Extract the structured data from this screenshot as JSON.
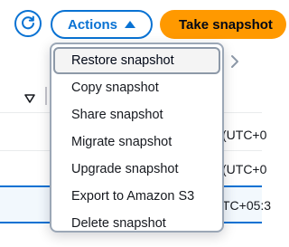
{
  "toolbar": {
    "refresh_icon": "refresh-icon",
    "actions_label": "Actions",
    "actions_icon": "caret-up-icon",
    "primary_label": "Take snapshot"
  },
  "actions_menu": {
    "items": [
      {
        "label": "Restore snapshot",
        "state": "highlighted"
      },
      {
        "label": "Copy snapshot"
      },
      {
        "label": "Share snapshot"
      },
      {
        "label": "Migrate snapshot"
      },
      {
        "label": "Upgrade snapshot"
      },
      {
        "label": "Export to Amazon S3"
      },
      {
        "label": "Delete snapshot"
      }
    ]
  },
  "table": {
    "rows": [
      {
        "time_fragment": "(UTC+0"
      },
      {
        "time_fragment": "(UTC+0"
      },
      {
        "time_fragment": "TC+05:3",
        "selected": true
      }
    ]
  },
  "colors": {
    "accent": "#0972d3",
    "primary_button": "#ff9900",
    "menu_border": "#9ba7b6"
  }
}
